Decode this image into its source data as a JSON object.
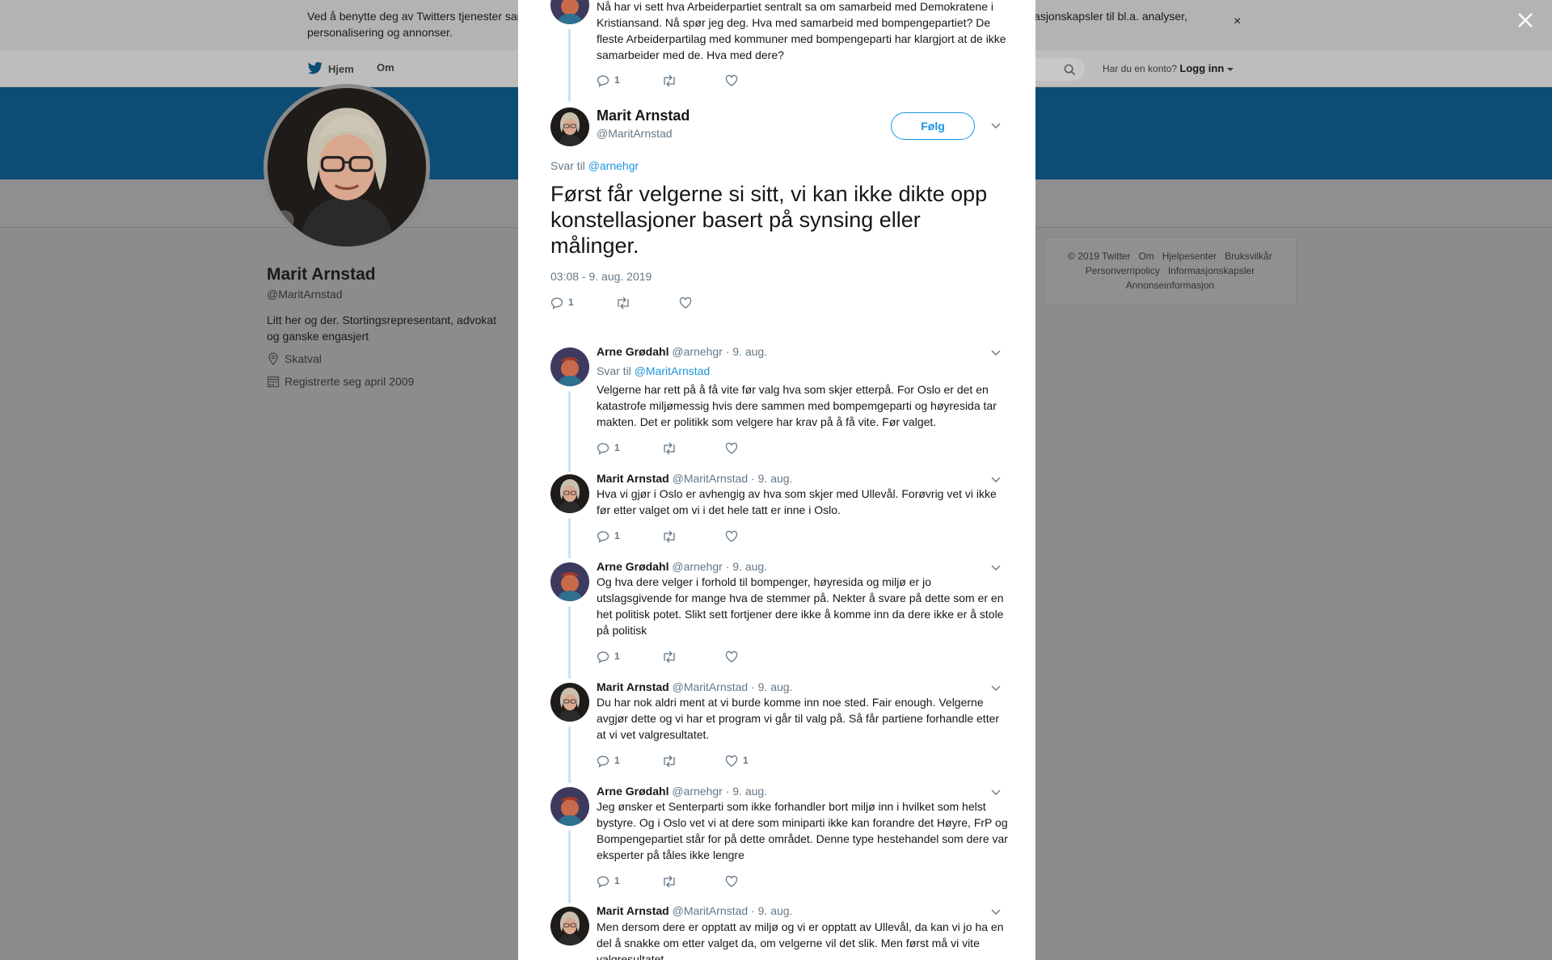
{
  "cookie": {
    "text": "Ved å benytte deg av Twitters tjenester samtykker du i vår bruk av informasjonskapsler. Twitter og våre partnere opererer globalt og bruker informasjonskapsler til bl.a. analyser, personalisering og annonser.",
    "close": "×"
  },
  "nav": {
    "home": "Hjem",
    "about": "Om",
    "have_account": "Har du en konto?",
    "login": "Logg inn"
  },
  "profile": {
    "name": "Marit Arnstad",
    "handle": "@MaritArnstad",
    "bio": "Litt her og der. Stortingsrepresentant, advokat og ganske engasjert",
    "location": "Skatval",
    "joined": "Registrerte seg april 2009"
  },
  "footer": {
    "links": [
      "© 2019 Twitter",
      "Om",
      "Hjelpesenter",
      "Bruksvilkår",
      "Personvernpolicy",
      "Informasjonskapsler",
      "Annonseinformasjon"
    ]
  },
  "prev_tweet": {
    "text": "Nå har vi sett hva Arbeiderpartiet sentralt sa om samarbeid med Demokratene i Kristiansand. Nå spør jeg deg. Hva med samarbeid med bompengepartiet? De fleste Arbeiderpartilag med kommuner med bompengeparti har klargjort at de ikke samarbeider med de. Hva med dere?",
    "replies": "1",
    "retweets": "",
    "likes": ""
  },
  "main_tweet": {
    "name": "Marit Arnstad",
    "handle": "@MaritArnstad",
    "follow": "Følg",
    "reply_prefix": "Svar til",
    "reply_to": "@arnehgr",
    "text": "Først får velgerne si sitt, vi kan ikke dikte opp konstellasjoner basert på synsing eller målinger.",
    "time": "03:08 - 9. aug. 2019",
    "replies": "1",
    "retweets": "",
    "likes": ""
  },
  "replies": [
    {
      "name": "Arne Grødahl",
      "handle": "@arnehgr",
      "date": "· 9. aug.",
      "reply_prefix": "Svar til",
      "reply_to": "@MaritArnstad",
      "text": "Velgerne har rett på å få vite før valg hva som skjer etterpå. For Oslo er det en katastrofe miljømessig hvis dere sammen med bompemgeparti og høyresida tar makten. Det er politikk som velgere har krav på å få vite. Før valget.",
      "replies": "1",
      "retweets": "",
      "likes": ""
    },
    {
      "name": "Marit Arnstad",
      "handle": "@MaritArnstad",
      "date": "· 9. aug.",
      "text": "Hva vi gjør i Oslo er avhengig av hva som skjer med Ullevål. Forøvrig vet vi ikke før etter valget om vi i det hele tatt er inne i Oslo.",
      "replies": "1",
      "retweets": "",
      "likes": ""
    },
    {
      "name": "Arne Grødahl",
      "handle": "@arnehgr",
      "date": "· 9. aug.",
      "text": "Og hva dere velger i forhold til bompenger, høyresida og miljø er jo utslagsgivende for mange hva de stemmer på. Nekter å svare på dette som er en het politisk potet. Slikt sett fortjener dere ikke å komme inn da dere ikke er å stole på politisk",
      "replies": "1",
      "retweets": "",
      "likes": ""
    },
    {
      "name": "Marit Arnstad",
      "handle": "@MaritArnstad",
      "date": "· 9. aug.",
      "text": "Du har nok aldri ment at vi burde komme inn noe sted. Fair enough. Velgerne avgjør dette og vi har et program vi går til valg på. Så får partiene forhandle etter at vi vet valgresultatet.",
      "replies": "1",
      "retweets": "",
      "likes": "1"
    },
    {
      "name": "Arne Grødahl",
      "handle": "@arnehgr",
      "date": "· 9. aug.",
      "text": "Jeg ønsker et Senterparti som ikke forhandler bort miljø inn i hvilket som helst bystyre. Og i Oslo vet vi at dere som miniparti ikke kan forandre det Høyre, FrP og Bompengepartiet står for på dette området. Denne type hestehandel som dere var eksperter på tåles ikke lengre",
      "replies": "1",
      "retweets": "",
      "likes": ""
    },
    {
      "name": "Marit Arnstad",
      "handle": "@MaritArnstad",
      "date": "· 9. aug.",
      "text": "Men dersom dere er opptatt av miljø og vi er opptatt av Ullevål, da kan vi jo ha en del å snakke om etter valget da, om velgerne vil det slik. Men først må vi vite valgresultatet.",
      "replies": "",
      "retweets": "",
      "likes": ""
    }
  ],
  "colors": {
    "link": "#1b95e0",
    "thread_line": "#c4e4f5",
    "overlay": "#8c8c8c"
  }
}
